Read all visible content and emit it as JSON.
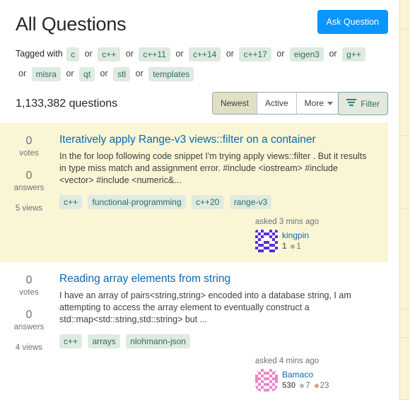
{
  "header": {
    "title": "All Questions",
    "ask_button": "Ask Question"
  },
  "tagged_with": {
    "label": "Tagged with",
    "separator": "or",
    "tags": [
      "c",
      "c++",
      "c++11",
      "c++14",
      "c++17",
      "eigen3",
      "g++",
      "misra",
      "qt",
      "stl",
      "templates"
    ]
  },
  "subheader": {
    "question_count": "1,133,382 questions",
    "sort_options": [
      {
        "label": "Newest",
        "selected": true
      },
      {
        "label": "Active",
        "selected": false
      },
      {
        "label": "More",
        "selected": false,
        "has_caret": true
      }
    ],
    "filter_label": "Filter",
    "filter_icon": "filter-icon"
  },
  "questions": [
    {
      "highlighted": true,
      "votes": "0",
      "votes_label": "votes",
      "answers": "0",
      "answers_label": "answers",
      "views": "5 views",
      "title": "Iteratively apply Range-v3 views::filter on a container",
      "excerpt": "In the for loop following code snippet I'm trying apply views::filter . But it results in type miss match and assignment error. #include <iostream> #include <vector> #include <numeric&...",
      "tags": [
        "c++",
        "functional-programming",
        "c++20",
        "range-v3"
      ],
      "asked": "asked 3 mins ago",
      "user": "kingpin",
      "reputation": "1",
      "badges": [
        {
          "type": "bronze",
          "count": "1"
        }
      ]
    },
    {
      "highlighted": false,
      "votes": "0",
      "votes_label": "votes",
      "answers": "0",
      "answers_label": "answers",
      "views": "4 views",
      "title": "Reading array elements from string",
      "excerpt": "I have an array of pairs<string,string> encoded into a database string, I am attempting to access the array element to eventually construct a std::map<std::string,std::string> but ...",
      "tags": [
        "c++",
        "arrays",
        "nlohmann-json"
      ],
      "asked": "asked 4 mins ago",
      "user": "Bamaco",
      "reputation": "530",
      "badges": [
        {
          "type": "silver",
          "count": "7"
        },
        {
          "type": "bronze",
          "count": "23"
        }
      ]
    }
  ],
  "colors": {
    "accent_blue": "#0a95ff",
    "link_blue": "#0c69b0",
    "tag_bg": "#dfeae1",
    "tag_text": "#2c6e63",
    "highlight_bg": "#faf6d5",
    "selected_sort_bg": "#dfe0c4",
    "filter_border": "#7aa6a0",
    "rail_bg": "#fbf3d5"
  }
}
